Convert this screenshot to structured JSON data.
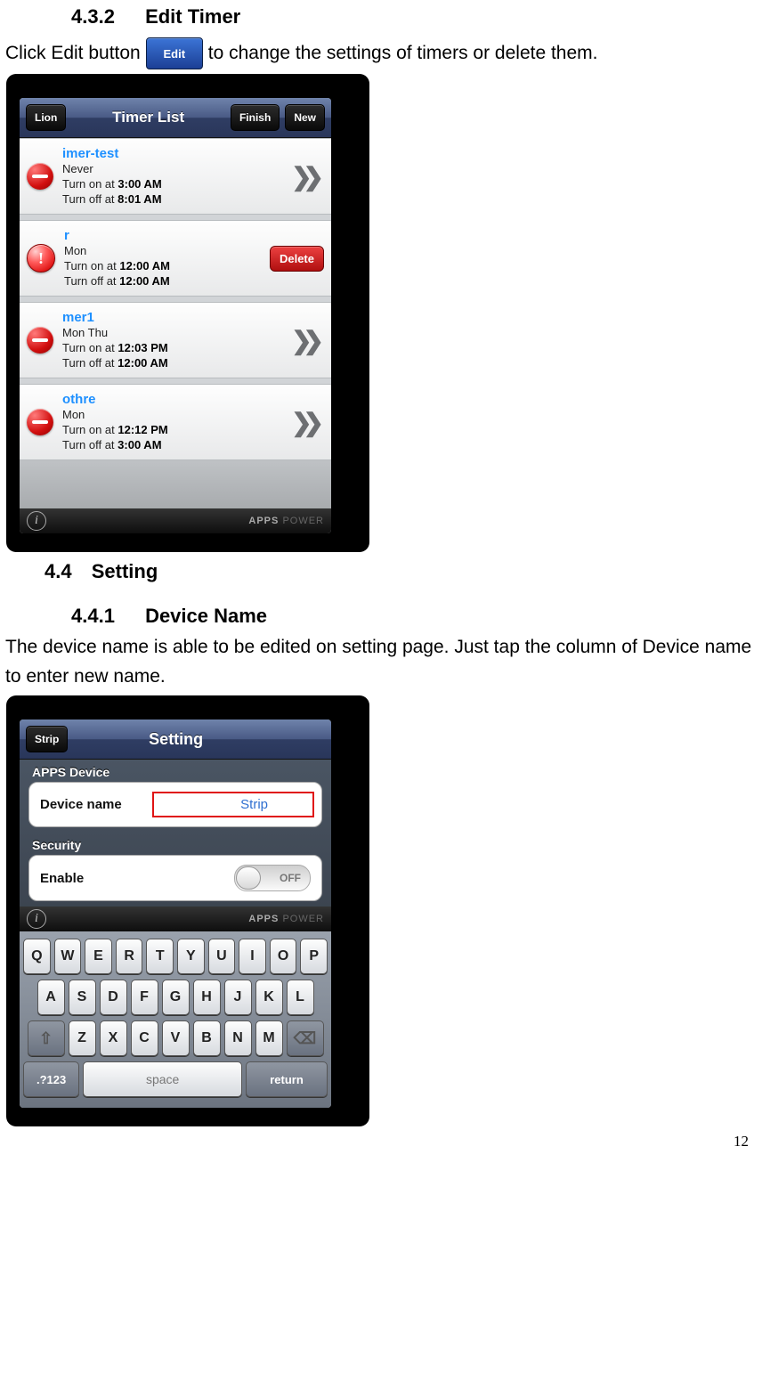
{
  "headings": {
    "h432_num": "4.3.2",
    "h432_title": "Edit Timer",
    "h44_num": "4.4",
    "h44_title": "Setting",
    "h441_num": "4.4.1",
    "h441_title": "Device Name"
  },
  "body": {
    "click_edit_prefix": "Click Edit button",
    "click_edit_suffix": "to change the settings of timers or delete them.",
    "device_name_para": "The device name is able to be edited on setting page. Just tap the column of Device name to enter new name."
  },
  "edit_button_label": "Edit",
  "timer_screen": {
    "back_label": "Lion",
    "title": "Timer List",
    "finish_label": "Finish",
    "new_label": "New",
    "delete_label": "Delete",
    "rows": [
      {
        "name": "imer-test",
        "repeat": "Never",
        "on_label": "Turn on at ",
        "on_time": "3:00 AM",
        "off_label": "Turn off at ",
        "off_time": "8:01 AM",
        "icon": "minus",
        "action": "chev"
      },
      {
        "name": "r",
        "repeat": "Mon",
        "on_label": "Turn on at ",
        "on_time": "12:00 AM",
        "off_label": "Turn off at ",
        "off_time": "12:00 AM",
        "icon": "i",
        "action": "delete"
      },
      {
        "name": "mer1",
        "repeat": "Mon Thu",
        "on_label": "Turn on at ",
        "on_time": "12:03 PM",
        "off_label": "Turn off at ",
        "off_time": "12:00 AM",
        "icon": "minus",
        "action": "chev"
      },
      {
        "name": "othre",
        "repeat": "Mon",
        "on_label": "Turn on at ",
        "on_time": "12:12 PM",
        "off_label": "Turn off at ",
        "off_time": "3:00 AM",
        "icon": "minus",
        "action": "chev"
      }
    ],
    "footer_brand_a": "APPS",
    "footer_brand_b": "POWER"
  },
  "setting_screen": {
    "back_label": "Strip",
    "title": "Setting",
    "section_device": "APPS Device",
    "device_name_label": "Device name",
    "device_name_value": "Strip",
    "section_security": "Security",
    "enable_label": "Enable",
    "toggle_value": "OFF",
    "footer_brand_a": "APPS",
    "footer_brand_b": "POWER"
  },
  "keyboard": {
    "row1": [
      "Q",
      "W",
      "E",
      "R",
      "T",
      "Y",
      "U",
      "I",
      "O",
      "P"
    ],
    "row2": [
      "A",
      "S",
      "D",
      "F",
      "G",
      "H",
      "J",
      "K",
      "L"
    ],
    "row3": [
      "Z",
      "X",
      "C",
      "V",
      "B",
      "N",
      "M"
    ],
    "shift": "⇧",
    "backspace": "⌫",
    "numkey": ".?123",
    "space": "space",
    "return": "return"
  },
  "page_number": "12"
}
